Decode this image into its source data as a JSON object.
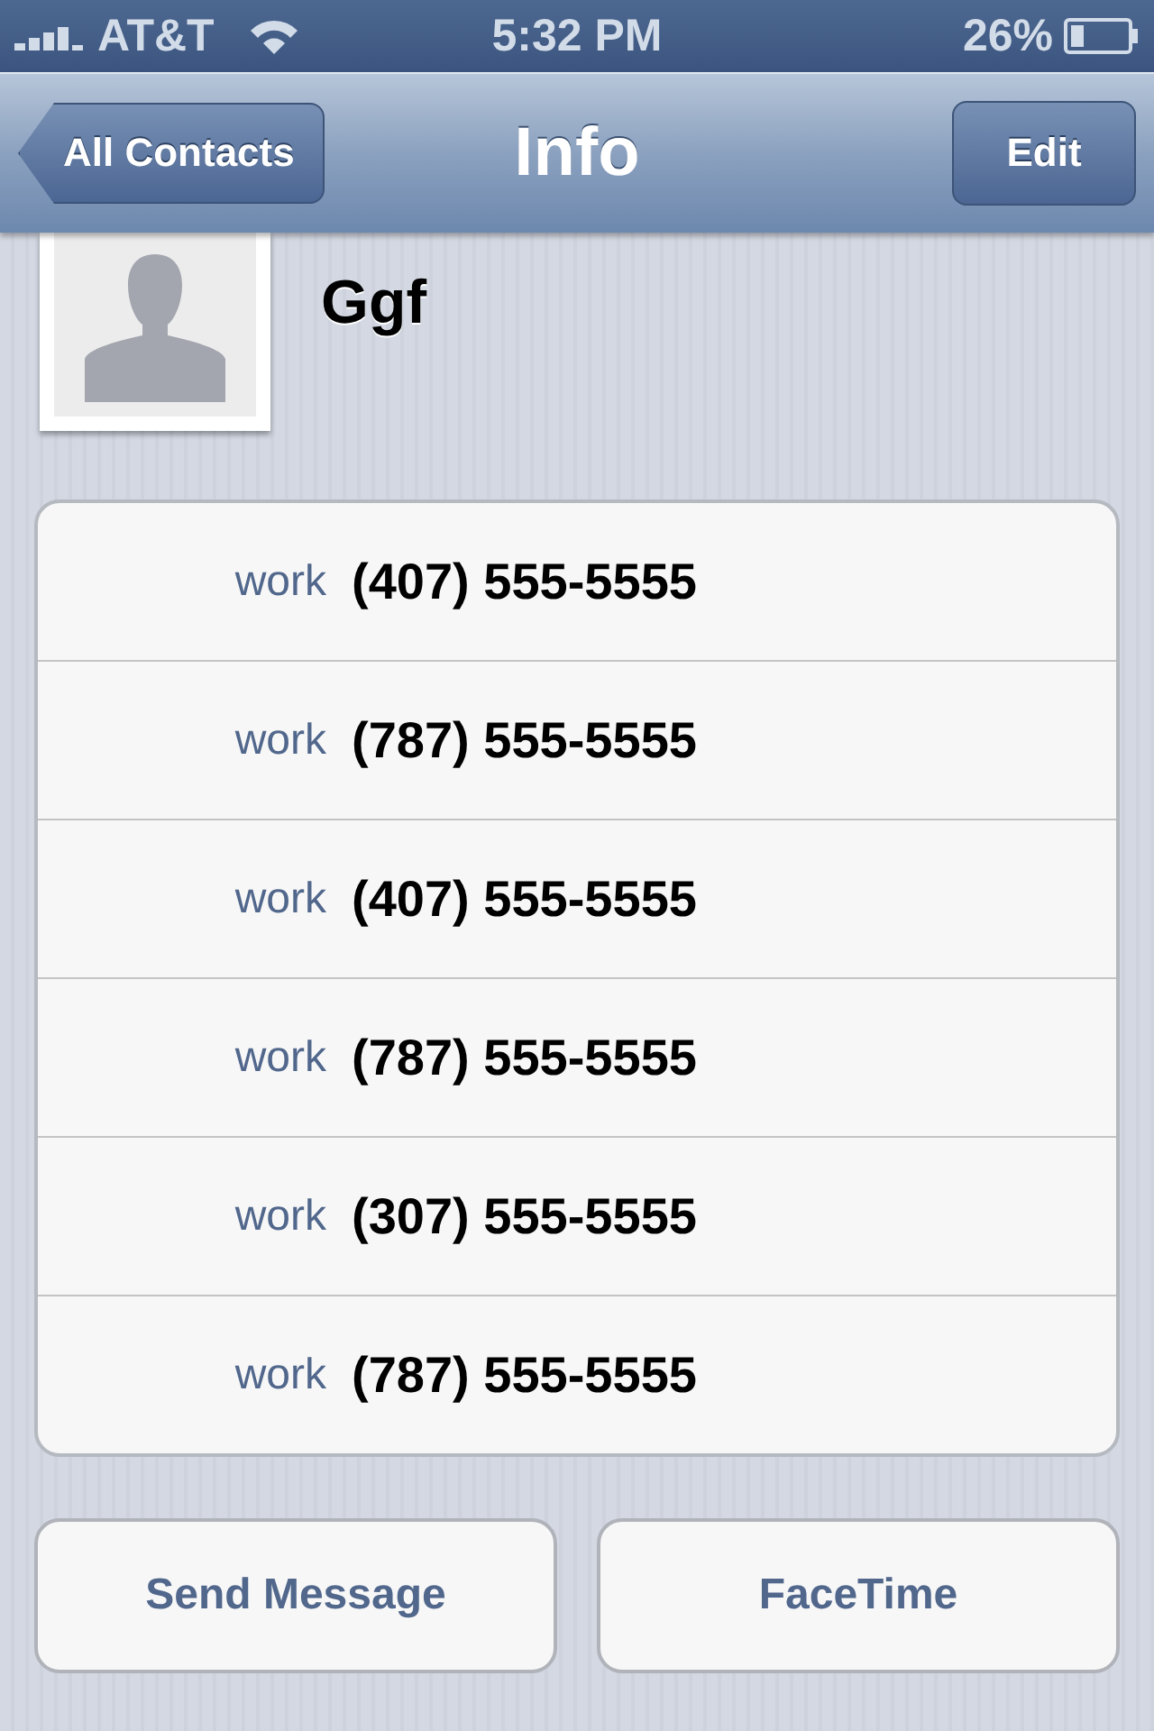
{
  "status_bar": {
    "carrier": "AT&T",
    "time": "5:32 PM",
    "battery": "26%"
  },
  "nav_bar": {
    "back": "All Contacts",
    "title": "Info",
    "action": "Edit"
  },
  "contact": {
    "name": "Ggf"
  },
  "phones": [
    {
      "label": "work",
      "number": "(407) 555-5555"
    },
    {
      "label": "work",
      "number": "(787) 555-5555"
    },
    {
      "label": "work",
      "number": "(407) 555-5555"
    },
    {
      "label": "work",
      "number": "(787) 555-5555"
    },
    {
      "label": "work",
      "number": "(307) 555-5555"
    },
    {
      "label": "work",
      "number": "(787) 555-5555"
    }
  ],
  "buttons": [
    "Send Message",
    "FaceTime"
  ]
}
